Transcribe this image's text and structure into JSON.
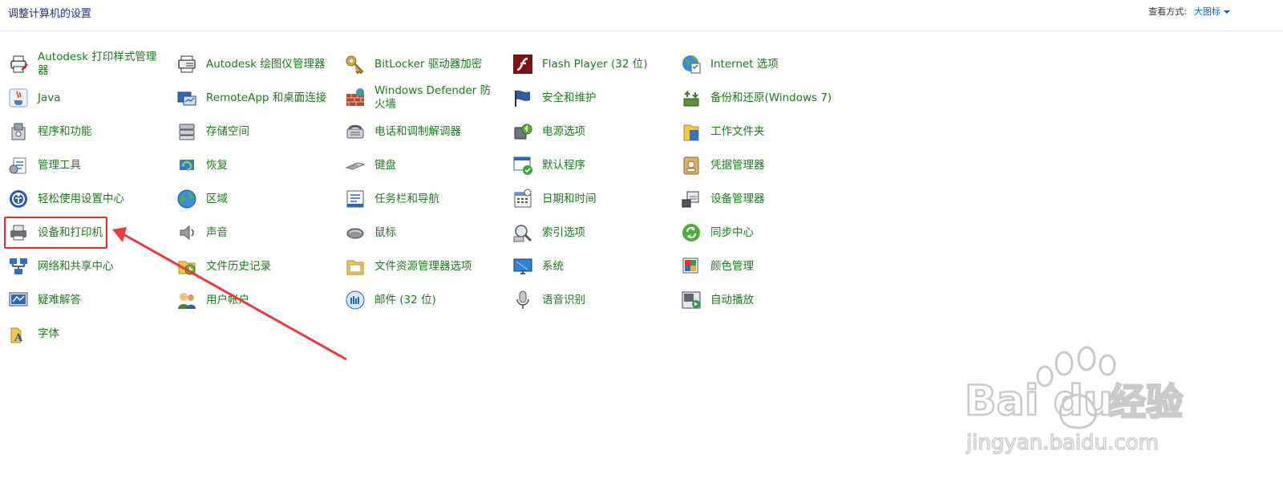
{
  "header": {
    "title": "调整计算机的设置",
    "view_by_label": "查看方式:",
    "view_by_value": "大图标"
  },
  "items": [
    {
      "label": "Autodesk 打印样式管理器",
      "icon": "printer-style-icon",
      "col": 0,
      "row": 0
    },
    {
      "label": "Java",
      "icon": "java-icon",
      "col": 0,
      "row": 1
    },
    {
      "label": "程序和功能",
      "icon": "programs-icon",
      "col": 0,
      "row": 2
    },
    {
      "label": "管理工具",
      "icon": "admin-tools-icon",
      "col": 0,
      "row": 3
    },
    {
      "label": "轻松使用设置中心",
      "icon": "ease-of-access-icon",
      "col": 0,
      "row": 4
    },
    {
      "label": "设备和打印机",
      "icon": "devices-printers-icon",
      "col": 0,
      "row": 5
    },
    {
      "label": "网络和共享中心",
      "icon": "network-icon",
      "col": 0,
      "row": 6
    },
    {
      "label": "疑难解答",
      "icon": "troubleshoot-icon",
      "col": 0,
      "row": 7
    },
    {
      "label": "字体",
      "icon": "fonts-icon",
      "col": 0,
      "row": 8
    },
    {
      "label": "Autodesk 绘图仪管理器",
      "icon": "plotter-icon",
      "col": 1,
      "row": 0
    },
    {
      "label": "RemoteApp 和桌面连接",
      "icon": "remoteapp-icon",
      "col": 1,
      "row": 1
    },
    {
      "label": "存储空间",
      "icon": "storage-icon",
      "col": 1,
      "row": 2
    },
    {
      "label": "恢复",
      "icon": "recovery-icon",
      "col": 1,
      "row": 3
    },
    {
      "label": "区域",
      "icon": "region-globe-icon",
      "col": 1,
      "row": 4
    },
    {
      "label": "声音",
      "icon": "speaker-icon",
      "col": 1,
      "row": 5
    },
    {
      "label": "文件历史记录",
      "icon": "file-history-icon",
      "col": 1,
      "row": 6
    },
    {
      "label": "用户帐户",
      "icon": "user-accounts-icon",
      "col": 1,
      "row": 7
    },
    {
      "label": "BitLocker 驱动器加密",
      "icon": "bitlocker-key-icon",
      "col": 2,
      "row": 0
    },
    {
      "label": "Windows Defender 防火墙",
      "icon": "firewall-icon",
      "col": 2,
      "row": 1
    },
    {
      "label": "电话和调制解调器",
      "icon": "phone-modem-icon",
      "col": 2,
      "row": 2
    },
    {
      "label": "键盘",
      "icon": "keyboard-icon",
      "col": 2,
      "row": 3
    },
    {
      "label": "任务栏和导航",
      "icon": "taskbar-icon",
      "col": 2,
      "row": 4
    },
    {
      "label": "鼠标",
      "icon": "mouse-icon",
      "col": 2,
      "row": 5
    },
    {
      "label": "文件资源管理器选项",
      "icon": "folder-options-icon",
      "col": 2,
      "row": 6
    },
    {
      "label": "邮件 (32 位)",
      "icon": "mail-icon",
      "col": 2,
      "row": 7
    },
    {
      "label": "Flash Player (32 位)",
      "icon": "flash-icon",
      "col": 3,
      "row": 0
    },
    {
      "label": "安全和维护",
      "icon": "security-flag-icon",
      "col": 3,
      "row": 1
    },
    {
      "label": "电源选项",
      "icon": "power-options-icon",
      "col": 3,
      "row": 2
    },
    {
      "label": "默认程序",
      "icon": "default-programs-icon",
      "col": 3,
      "row": 3
    },
    {
      "label": "日期和时间",
      "icon": "date-time-icon",
      "col": 3,
      "row": 4
    },
    {
      "label": "索引选项",
      "icon": "indexing-icon",
      "col": 3,
      "row": 5
    },
    {
      "label": "系统",
      "icon": "system-monitor-icon",
      "col": 3,
      "row": 6
    },
    {
      "label": "语音识别",
      "icon": "microphone-icon",
      "col": 3,
      "row": 7
    },
    {
      "label": "Internet 选项",
      "icon": "internet-options-icon",
      "col": 4,
      "row": 0
    },
    {
      "label": "备份和还原(Windows 7)",
      "icon": "backup-restore-icon",
      "col": 4,
      "row": 1
    },
    {
      "label": "工作文件夹",
      "icon": "work-folders-icon",
      "col": 4,
      "row": 2
    },
    {
      "label": "凭据管理器",
      "icon": "credential-manager-icon",
      "col": 4,
      "row": 3
    },
    {
      "label": "设备管理器",
      "icon": "device-manager-icon",
      "col": 4,
      "row": 4
    },
    {
      "label": "同步中心",
      "icon": "sync-center-icon",
      "col": 4,
      "row": 5
    },
    {
      "label": "颜色管理",
      "icon": "color-management-icon",
      "col": 4,
      "row": 6
    },
    {
      "label": "自动播放",
      "icon": "autoplay-icon",
      "col": 4,
      "row": 7
    }
  ],
  "annotation": {
    "highlight_color": "#e03131"
  },
  "watermark": {
    "brand": "Bai du",
    "suffix": "经验",
    "url": "jingyan.baidu.com"
  },
  "colors": {
    "item_text": "#1e7a1e",
    "title_text": "#1e3287",
    "link": "#0066cc"
  }
}
